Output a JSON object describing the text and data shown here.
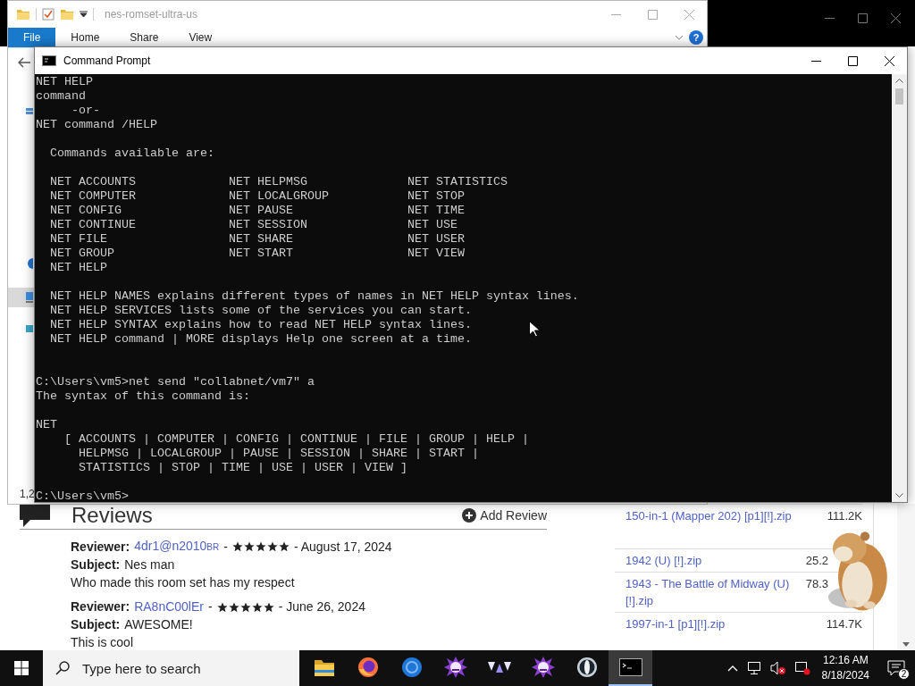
{
  "explorer": {
    "title": "nes-romset-ultra-us",
    "ribbon_tabs": [
      {
        "label": "File",
        "selected": true
      },
      {
        "label": "Home",
        "selected": false
      },
      {
        "label": "Share",
        "selected": false
      },
      {
        "label": "View",
        "selected": false
      }
    ],
    "help": "?",
    "status": "1,2"
  },
  "browser": {
    "reviews": {
      "title": "Reviews",
      "add_button": "Add Review",
      "items": [
        {
          "reviewer_label": "Reviewer:",
          "reviewer": "4dr1@n2010",
          "reviewer_badge": "BR",
          "separator": "-",
          "stars": 5,
          "date": "- August 17, 2024",
          "subject_label": "Subject:",
          "subject": "Nes man",
          "body": "Who made this room set has my respect"
        },
        {
          "reviewer_label": "Reviewer:",
          "reviewer": "RA8nC00lEr",
          "separator": "-",
          "stars": 5,
          "date": "- June 26, 2024",
          "subject_label": "Subject:",
          "subject": "AWESOME!",
          "body": "This is cool"
        }
      ]
    },
    "files": [
      {
        "name": "150-in-1 (Mapper 202) [p1][!].zip",
        "size": "111.2K"
      },
      {
        "name": "1942 (U) [!].zip",
        "size": "25.2"
      },
      {
        "name": "1943 - The Battle of Midway (U) [!].zip",
        "size": "78.3"
      },
      {
        "name": "1997-in-1 [p1][!].zip",
        "size": "114.7K"
      }
    ]
  },
  "command_prompt": {
    "title": "Command Prompt",
    "lines": [
      {
        "kind": "text",
        "text": "NET HELP"
      },
      {
        "kind": "text",
        "text": "command"
      },
      {
        "kind": "text",
        "text": "     -or-"
      },
      {
        "kind": "text",
        "text": "NET command /HELP"
      },
      {
        "kind": "blank"
      },
      {
        "kind": "text",
        "text": "  Commands available are:"
      },
      {
        "kind": "blank"
      },
      {
        "kind": "text",
        "text": "  NET ACCOUNTS             NET HELPMSG              NET STATISTICS"
      },
      {
        "kind": "text",
        "text": "  NET COMPUTER             NET LOCALGROUP           NET STOP"
      },
      {
        "kind": "text",
        "text": "  NET CONFIG               NET PAUSE                NET TIME"
      },
      {
        "kind": "text",
        "text": "  NET CONTINUE             NET SESSION              NET USE"
      },
      {
        "kind": "text",
        "text": "  NET FILE                 NET SHARE                NET USER"
      },
      {
        "kind": "text",
        "text": "  NET GROUP                NET START                NET VIEW"
      },
      {
        "kind": "text",
        "text": "  NET HELP"
      },
      {
        "kind": "blank"
      },
      {
        "kind": "text",
        "text": "  NET HELP NAMES explains different types of names in NET HELP syntax lines."
      },
      {
        "kind": "text",
        "text": "  NET HELP SERVICES lists some of the services you can start."
      },
      {
        "kind": "text",
        "text": "  NET HELP SYNTAX explains how to read NET HELP syntax lines."
      },
      {
        "kind": "text",
        "text": "  NET HELP command | MORE displays Help one screen at a time."
      },
      {
        "kind": "blank"
      },
      {
        "kind": "blank"
      },
      {
        "kind": "text",
        "text": "C:\\Users\\vm5>net send \"collabnet/vm7\" a"
      },
      {
        "kind": "text",
        "text": "The syntax of this command is:"
      },
      {
        "kind": "blank"
      },
      {
        "kind": "text",
        "text": "NET"
      },
      {
        "kind": "text",
        "text": "    [ ACCOUNTS | COMPUTER | CONFIG | CONTINUE | FILE | GROUP | HELP |"
      },
      {
        "kind": "text",
        "text": "      HELPMSG | LOCALGROUP | PAUSE | SESSION | SHARE | START |"
      },
      {
        "kind": "text",
        "text": "      STATISTICS | STOP | TIME | USE | USER | VIEW ]"
      },
      {
        "kind": "blank"
      },
      {
        "kind": "text",
        "text": "C:\\Users\\vm5>"
      }
    ]
  },
  "taskbar": {
    "search_placeholder": "Type here to search",
    "apps": [
      {
        "kind": "folder",
        "selected": false
      },
      {
        "kind": "firefox",
        "selected": false
      },
      {
        "kind": "chrome",
        "selected": false
      },
      {
        "kind": "monster",
        "selected": false
      },
      {
        "kind": "peaks",
        "selected": false
      },
      {
        "kind": "monster",
        "selected": false
      },
      {
        "kind": "globe",
        "selected": false
      },
      {
        "kind": "console",
        "selected": true
      }
    ],
    "time": "12:16 AM",
    "date": "8/18/2024",
    "notifications": "2"
  }
}
